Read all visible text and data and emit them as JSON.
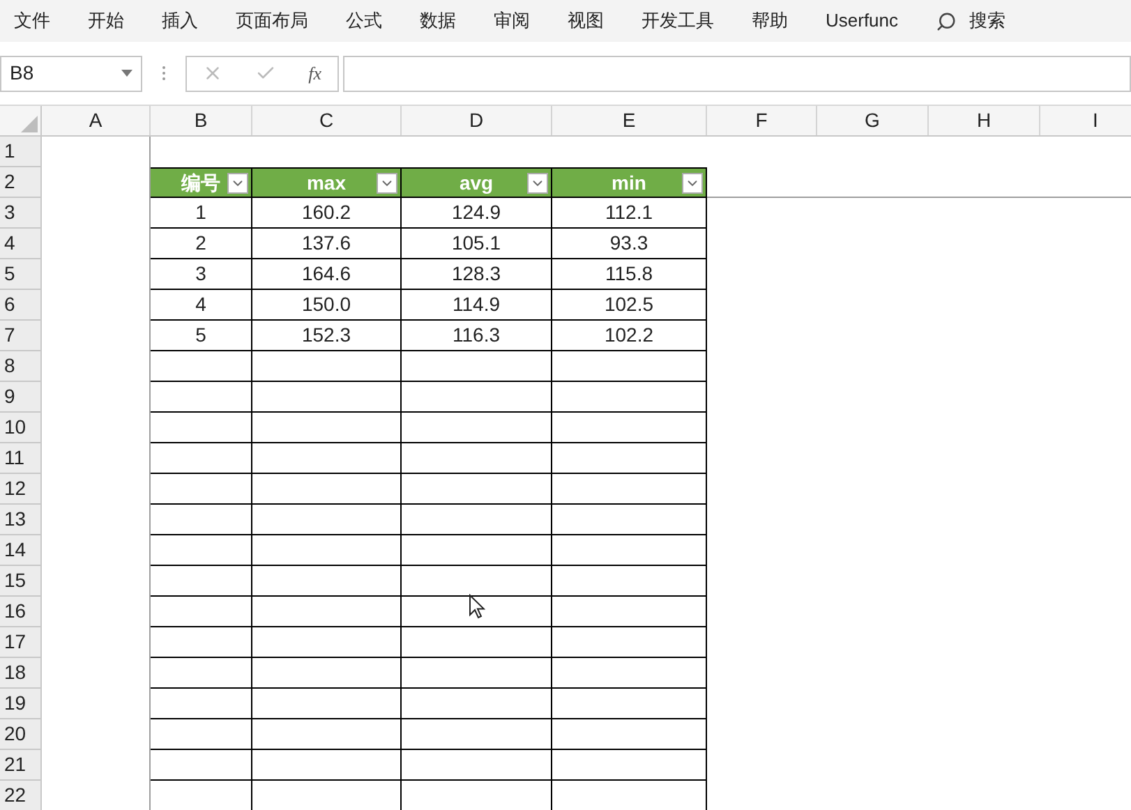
{
  "menu": [
    "文件",
    "开始",
    "插入",
    "页面布局",
    "公式",
    "数据",
    "审阅",
    "视图",
    "开发工具",
    "帮助",
    "Userfunc"
  ],
  "search": {
    "label": "搜索"
  },
  "formula_bar": {
    "name_box": "B8",
    "function_label": "fx"
  },
  "column_headers": [
    "A",
    "B",
    "C",
    "D",
    "E",
    "F",
    "G",
    "H",
    "I"
  ],
  "row_headers": [
    "1",
    "2",
    "3",
    "4",
    "5",
    "6",
    "7",
    "8",
    "9",
    "10",
    "11",
    "12",
    "13",
    "14",
    "15",
    "16",
    "17",
    "18",
    "19",
    "20",
    "21",
    "22"
  ],
  "table": {
    "columns": [
      "编号",
      "max",
      "avg",
      "min"
    ],
    "rows": [
      [
        "1",
        "160.2",
        "124.9",
        "112.1"
      ],
      [
        "2",
        "137.6",
        "105.1",
        "93.3"
      ],
      [
        "3",
        "164.6",
        "128.3",
        "115.8"
      ],
      [
        "4",
        "150.0",
        "114.9",
        "102.5"
      ],
      [
        "5",
        "152.3",
        "116.3",
        "102.2"
      ]
    ]
  }
}
